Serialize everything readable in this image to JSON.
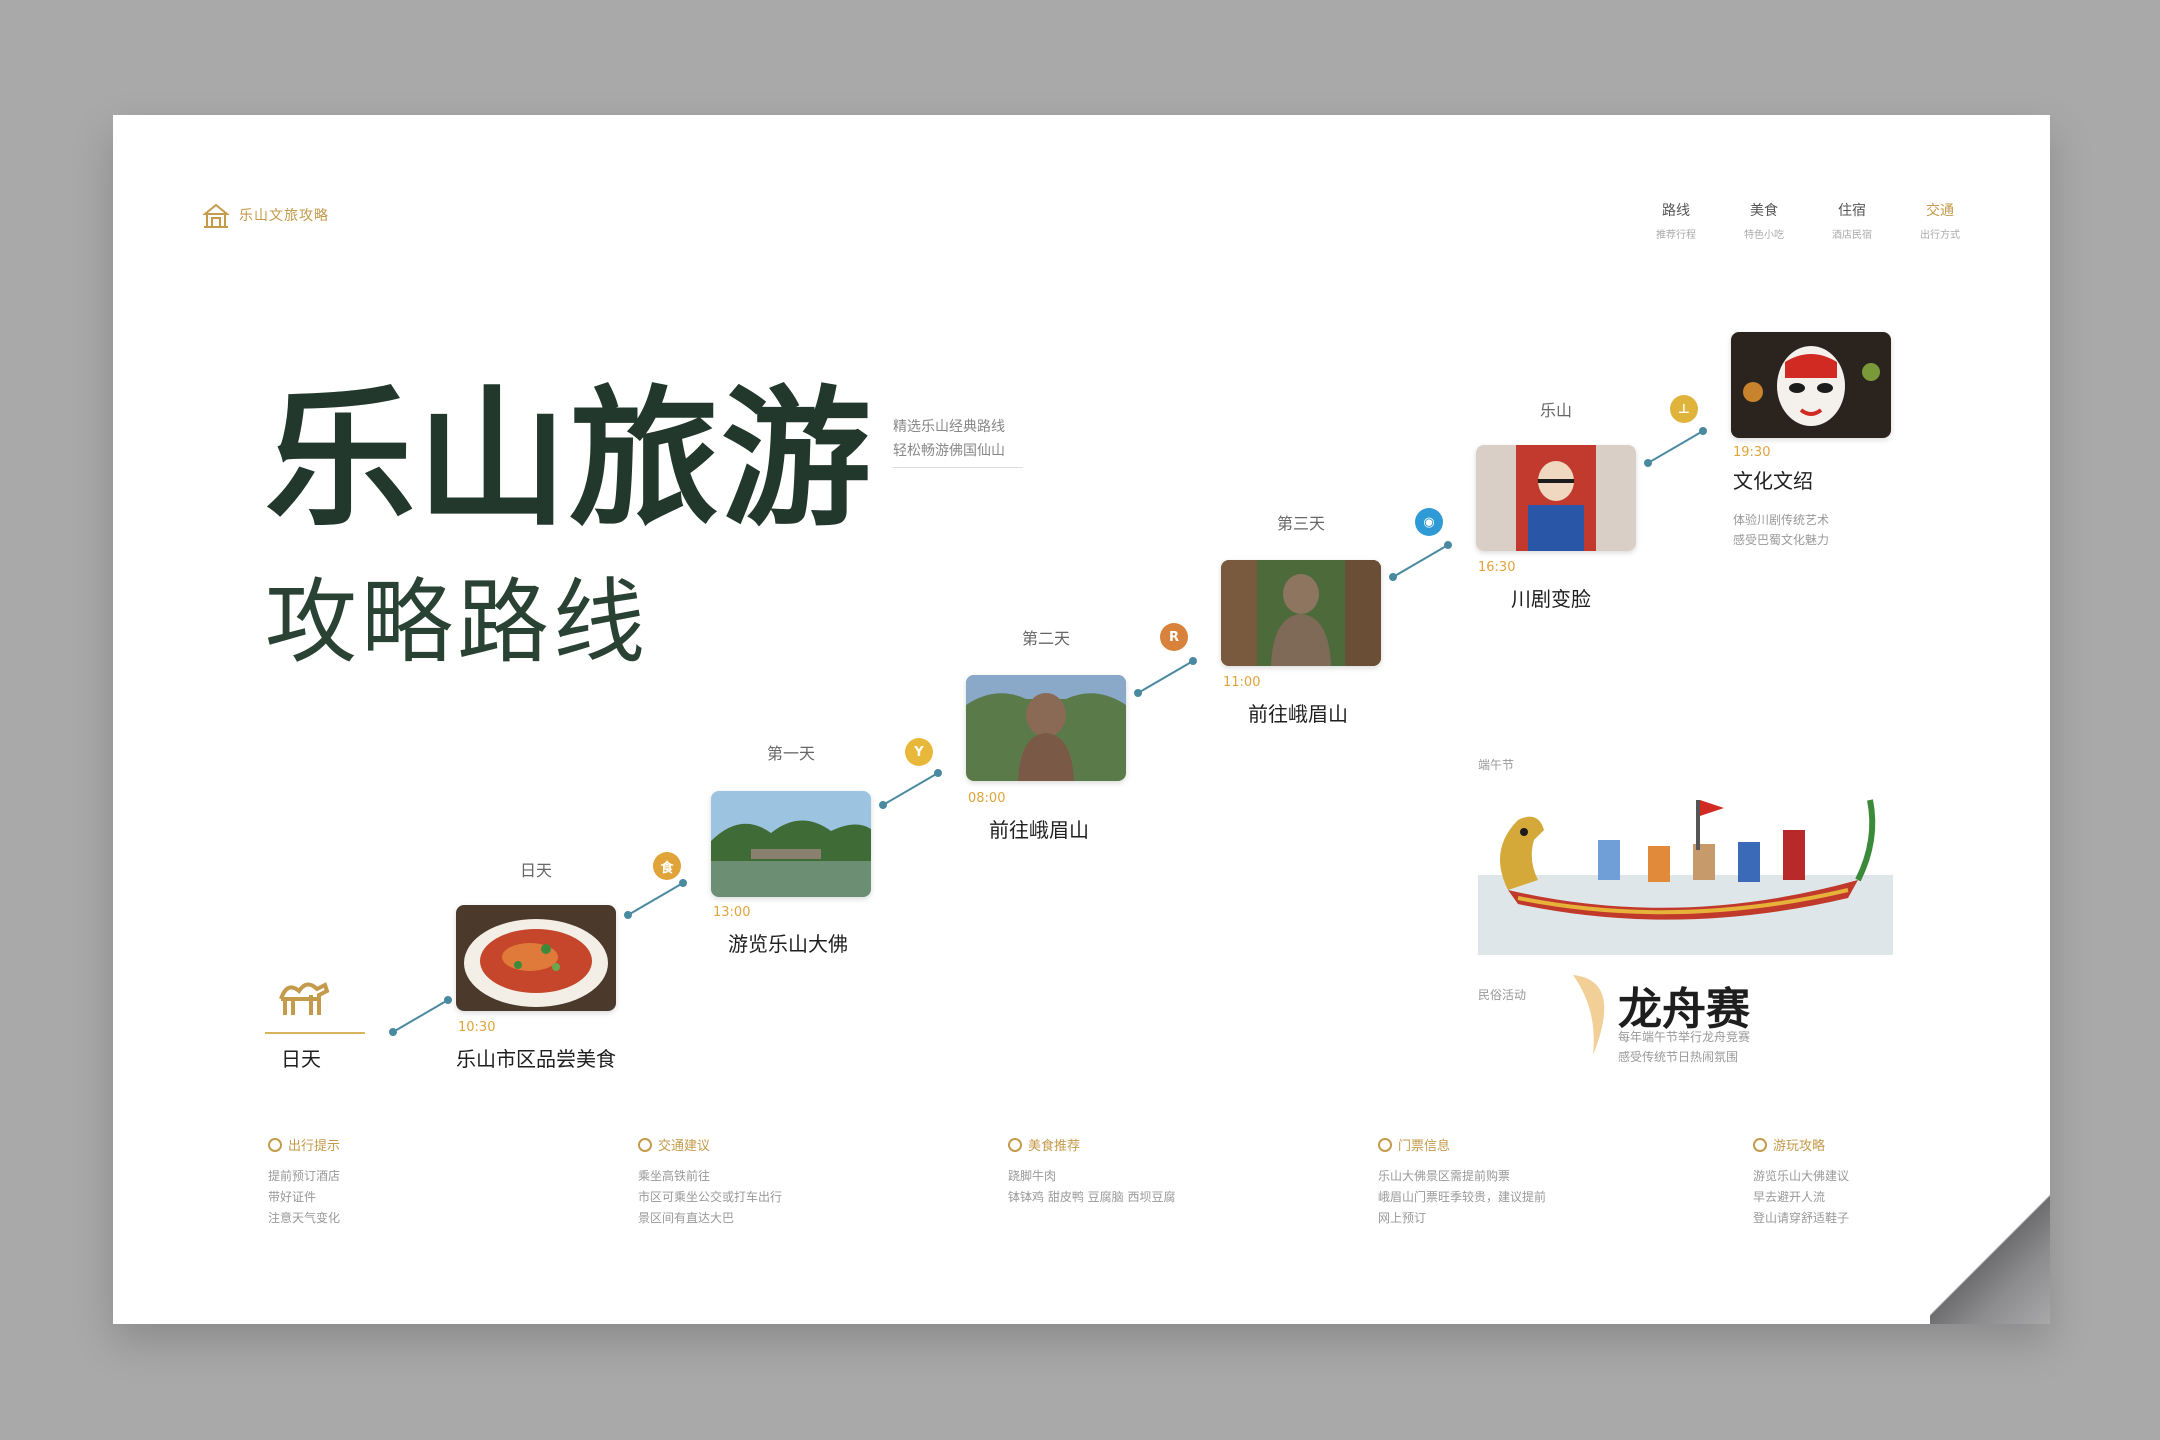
{
  "logo": {
    "text": "乐山文旅攻略"
  },
  "nav": [
    {
      "label": "路线",
      "sub": "推荐行程"
    },
    {
      "label": "美食",
      "sub": "特色小吃"
    },
    {
      "label": "住宿",
      "sub": "酒店民宿"
    },
    {
      "label": "交通",
      "sub": "出行方式"
    }
  ],
  "title": {
    "main": "乐山旅游",
    "sub": "攻略路线"
  },
  "intro": {
    "line1": "精选乐山经典路线",
    "line2": "轻松畅游佛国仙山"
  },
  "steps": [
    {
      "day": "日天",
      "time": "",
      "caption": ""
    },
    {
      "day": "日天",
      "time": "10:30",
      "caption": "乐山市区品尝美食",
      "badge": "食",
      "badge_color": "#e0a43b"
    },
    {
      "day": "第一天",
      "time": "13:00",
      "caption": "游览乐山大佛",
      "badge": "Y",
      "badge_color": "#e8b83a"
    },
    {
      "day": "第二天",
      "time": "08:00",
      "caption": "前往峨眉山",
      "badge": "R",
      "badge_color": "#d9823b"
    },
    {
      "day": "第三天",
      "time": "11:00",
      "caption": "前往峨眉山",
      "badge": "◉",
      "badge_color": "#2f9bd6"
    },
    {
      "day": "乐山",
      "time": "16:30",
      "caption": "川剧变脸",
      "badge": "⊥",
      "badge_color": "#e0b43a"
    },
    {
      "day": "",
      "time": "19:30",
      "caption": "文化文绍",
      "desc1": "体验川剧传统艺术",
      "desc2": "感受巴蜀文化魅力"
    }
  ],
  "dragon": {
    "label": "端午节",
    "side": "民俗活动",
    "title": "龙舟赛",
    "desc1": "每年端午节举行龙舟竞赛",
    "desc2": "感受传统节日热闹氛围"
  },
  "tips": [
    {
      "title": "出行提示",
      "lines": [
        "提前预订酒店",
        "带好证件",
        "注意天气变化"
      ]
    },
    {
      "title": "交通建议",
      "lines": [
        "乘坐高铁前往",
        "市区可乘坐公交或打车出行",
        "景区间有直达大巴"
      ]
    },
    {
      "title": "美食推荐",
      "lines": [
        "跷脚牛肉",
        "钵钵鸡 甜皮鸭 豆腐脑 西坝豆腐"
      ]
    },
    {
      "title": "门票信息",
      "lines": [
        "乐山大佛景区需提前购票",
        "峨眉山门票旺季较贵，建议提前",
        "网上预订"
      ]
    },
    {
      "title": "游玩攻略",
      "lines": [
        "游览乐山大佛建议",
        "早去避开人流",
        "登山请穿舒适鞋子"
      ]
    }
  ],
  "colors": {
    "title": "#22382c",
    "accent": "#c49a4b",
    "time": "#e0a43b"
  }
}
